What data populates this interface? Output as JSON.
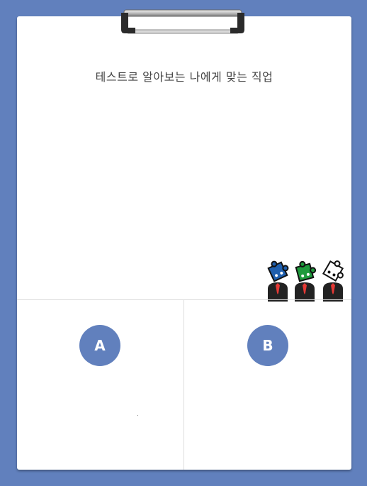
{
  "header": {
    "title": "테스트로 알아보는 나에게 맞는 직업"
  },
  "choices": [
    {
      "label": "A"
    },
    {
      "label": "B"
    }
  ],
  "colors": {
    "background": "#6180bd",
    "paper": "#ffffff",
    "highlight": "#f6df55",
    "circle": "#6180bd",
    "puzzle_blue": "#1f5fae",
    "puzzle_green": "#1e9a3c",
    "puzzle_white": "#ffffff",
    "tie": "#e53935"
  },
  "icons": [
    "clipboard-clip-icon",
    "puzzle-head-people-icon"
  ]
}
